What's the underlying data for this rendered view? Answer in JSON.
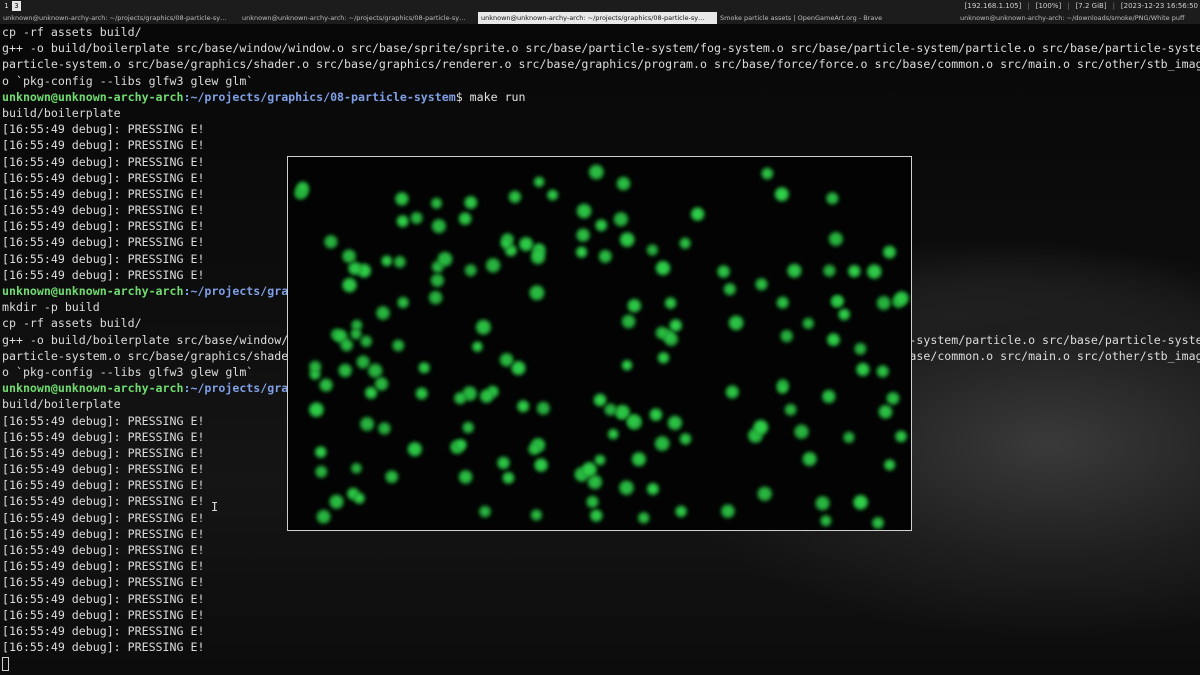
{
  "topbar": {
    "workspaces": [
      "1",
      "3"
    ],
    "active_workspace": "3",
    "status": {
      "ip": "[192.168.1.105]",
      "brightness": "[100%]",
      "memory": "[7.2 GiB]",
      "datetime": "[2023-12-23 16:56:50"
    },
    "separators": [
      "|",
      "|",
      "|"
    ]
  },
  "tabs": [
    {
      "label": "unknown@unknown-archy-arch: ~/projects/graphics/08-particle-sy…",
      "active": false
    },
    {
      "label": "unknown@unknown-archy-arch: ~/projects/graphics/08-particle-sy…",
      "active": false
    },
    {
      "label": "unknown@unknown-archy-arch: ~/projects/graphics/08-particle-sy…",
      "active": true
    },
    {
      "label": "Smoke particle assets | OpenGameArt.org - Brave",
      "active": false
    }
  ],
  "right_window_title": "unknown@unknown-archy-arch: ~/downloads/smoke/PNG/White puff",
  "terminal": {
    "prompt_user": "unknown@unknown-archy-arch",
    "prompt_path": ":~/projects/graphics/08-particle-system",
    "lines": [
      {
        "kind": "out",
        "text": "cp -rf assets build/"
      },
      {
        "kind": "out",
        "text": "g++ -o build/boilerplate src/base/window/window.o src/base/sprite/sprite.o src/base/particle-system/fog-system.o src/base/particle-system/particle.o src/base/particle-system/"
      },
      {
        "kind": "out",
        "text": "particle-system.o src/base/graphics/shader.o src/base/graphics/renderer.o src/base/graphics/program.o src/base/force/force.o src/base/common.o src/main.o src/other/stb_image."
      },
      {
        "kind": "out",
        "text": "o `pkg-config --libs glfw3 glew glm`"
      },
      {
        "kind": "prompt",
        "cmd": "$ make run"
      },
      {
        "kind": "out",
        "text": "build/boilerplate"
      },
      {
        "kind": "out",
        "text": "[16:55:49 debug]: PRESSING E!"
      },
      {
        "kind": "out",
        "text": "[16:55:49 debug]: PRESSING E!"
      },
      {
        "kind": "out",
        "text": "[16:55:49 debug]: PRESSING E!"
      },
      {
        "kind": "out",
        "text": "[16:55:49 debug]: PRESSING E!"
      },
      {
        "kind": "out",
        "text": "[16:55:49 debug]: PRESSING E!"
      },
      {
        "kind": "out",
        "text": "[16:55:49 debug]: PRESSING E!"
      },
      {
        "kind": "out",
        "text": "[16:55:49 debug]: PRESSING E!"
      },
      {
        "kind": "out",
        "text": "[16:55:49 debug]: PRESSING E!"
      },
      {
        "kind": "out",
        "text": "[16:55:49 debug]: PRESSING E!"
      },
      {
        "kind": "out",
        "text": "[16:55:49 debug]: PRESSING E!"
      },
      {
        "kind": "prompt",
        "cmd": ""
      },
      {
        "kind": "out",
        "text": "mkdir -p build"
      },
      {
        "kind": "out",
        "text": "cp -rf assets build/"
      },
      {
        "kind": "out",
        "text": "g++ -o build/boilerplate src/base/window/window.o src/base/sprite/sprite.o src/base/particle-system/fog-system.o src/base/particle-system/particle.o src/base/particle-system/"
      },
      {
        "kind": "out",
        "text": "particle-system.o src/base/graphics/shader.o src/base/graphics/renderer.o src/base/graphics/program.o src/base/force/force.o src/base/common.o src/main.o src/other/stb_image."
      },
      {
        "kind": "out",
        "text": "o `pkg-config --libs glfw3 glew glm`"
      },
      {
        "kind": "prompt",
        "cmd": ""
      },
      {
        "kind": "out",
        "text": "build/boilerplate"
      },
      {
        "kind": "out",
        "text": "[16:55:49 debug]: PRESSING E!"
      },
      {
        "kind": "out",
        "text": "[16:55:49 debug]: PRESSING E!"
      },
      {
        "kind": "out",
        "text": "[16:55:49 debug]: PRESSING E!"
      },
      {
        "kind": "out",
        "text": "[16:55:49 debug]: PRESSING E!"
      },
      {
        "kind": "out",
        "text": "[16:55:49 debug]: PRESSING E!"
      },
      {
        "kind": "out",
        "text": "[16:55:49 debug]: PRESSING E!"
      },
      {
        "kind": "out",
        "text": "[16:55:49 debug]: PRESSING E!"
      },
      {
        "kind": "out",
        "text": "[16:55:49 debug]: PRESSING E!"
      },
      {
        "kind": "out",
        "text": "[16:55:49 debug]: PRESSING E!"
      },
      {
        "kind": "out",
        "text": "[16:55:49 debug]: PRESSING E!"
      },
      {
        "kind": "out",
        "text": "[16:55:49 debug]: PRESSING E!"
      },
      {
        "kind": "out",
        "text": "[16:55:49 debug]: PRESSING E!"
      },
      {
        "kind": "out",
        "text": "[16:55:49 debug]: PRESSING E!"
      },
      {
        "kind": "out",
        "text": "[16:55:49 debug]: PRESSING E!"
      },
      {
        "kind": "out",
        "text": "[16:55:49 debug]: PRESSING E!"
      },
      {
        "kind": "cursor"
      }
    ]
  },
  "particle_window": {
    "particle_color": "#2fd04a",
    "particle_glow_color": "#1a8a2e",
    "background_color": "#030303"
  },
  "colors": {
    "prompt_user": "#6fdc6f",
    "prompt_path": "#7f9fe6",
    "terminal_text": "#dcdcdc"
  }
}
